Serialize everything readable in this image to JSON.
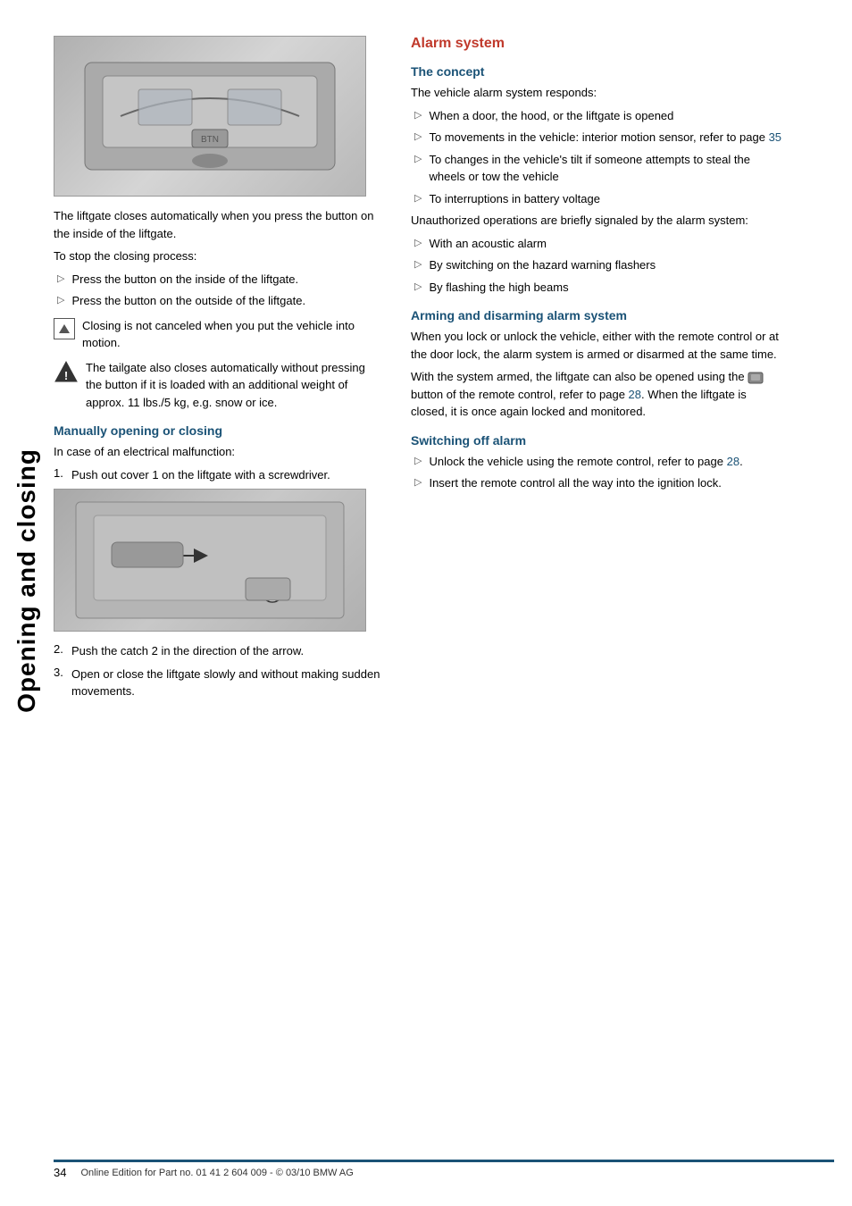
{
  "sidebar": {
    "text": "Opening and closing"
  },
  "left_column": {
    "liftgate_desc": "The liftgate closes automatically when you press the button on the inside of the liftgate.",
    "stop_process_label": "To stop the closing process:",
    "bullet1": "Press the button on the inside of the liftgate.",
    "bullet2": "Press the button on the outside of the liftgate.",
    "note1": "Closing is not canceled when you put the vehicle into motion.",
    "warning1": "The tailgate also closes automatically without pressing the button if it is loaded with an additional weight of approx. 11 lbs./5 kg, e.g. snow or ice.",
    "manual_heading": "Manually opening or closing",
    "manual_intro": "In case of an electrical malfunction:",
    "step1": "Push out cover 1 on the liftgate with a screwdriver.",
    "step2": "Push the catch 2 in the direction of the arrow.",
    "step3": "Open or close the liftgate slowly and without making sudden movements."
  },
  "right_column": {
    "alarm_heading": "Alarm system",
    "concept_heading": "The concept",
    "concept_intro": "The vehicle alarm system responds:",
    "concept_bullet1": "When a door, the hood, or the liftgate is opened",
    "concept_bullet2": "To movements in the vehicle: interior motion sensor, refer to page 35",
    "concept_bullet3": "To changes in the vehicle's tilt if someone attempts to steal the wheels or tow the vehicle",
    "concept_bullet4": "To interruptions in battery voltage",
    "unauthorized_text": "Unauthorized operations are briefly signaled by the alarm system:",
    "signal_bullet1": "With an acoustic alarm",
    "signal_bullet2": "By switching on the hazard warning flashers",
    "signal_bullet3": "By flashing the high beams",
    "arming_heading": "Arming and disarming alarm system",
    "arming_text1": "When you lock or unlock the vehicle, either with the remote control or at the door lock, the alarm system is armed or disarmed at the same time.",
    "arming_text2": "With the system armed, the liftgate can also be opened using the  button of the remote control, refer to page 28. When the liftgate is closed, it is once again locked and monitored.",
    "switching_heading": "Switching off alarm",
    "switching_bullet1": "Unlock the vehicle using the remote control, refer to page 28.",
    "switching_bullet2": "Insert the remote control all the way into the ignition lock.",
    "page_ref1": "28",
    "page_ref2": "35",
    "page_ref3": "28"
  },
  "footer": {
    "page_number": "34",
    "footer_text": "Online Edition for Part no. 01 41 2 604 009 - © 03/10 BMW AG"
  }
}
